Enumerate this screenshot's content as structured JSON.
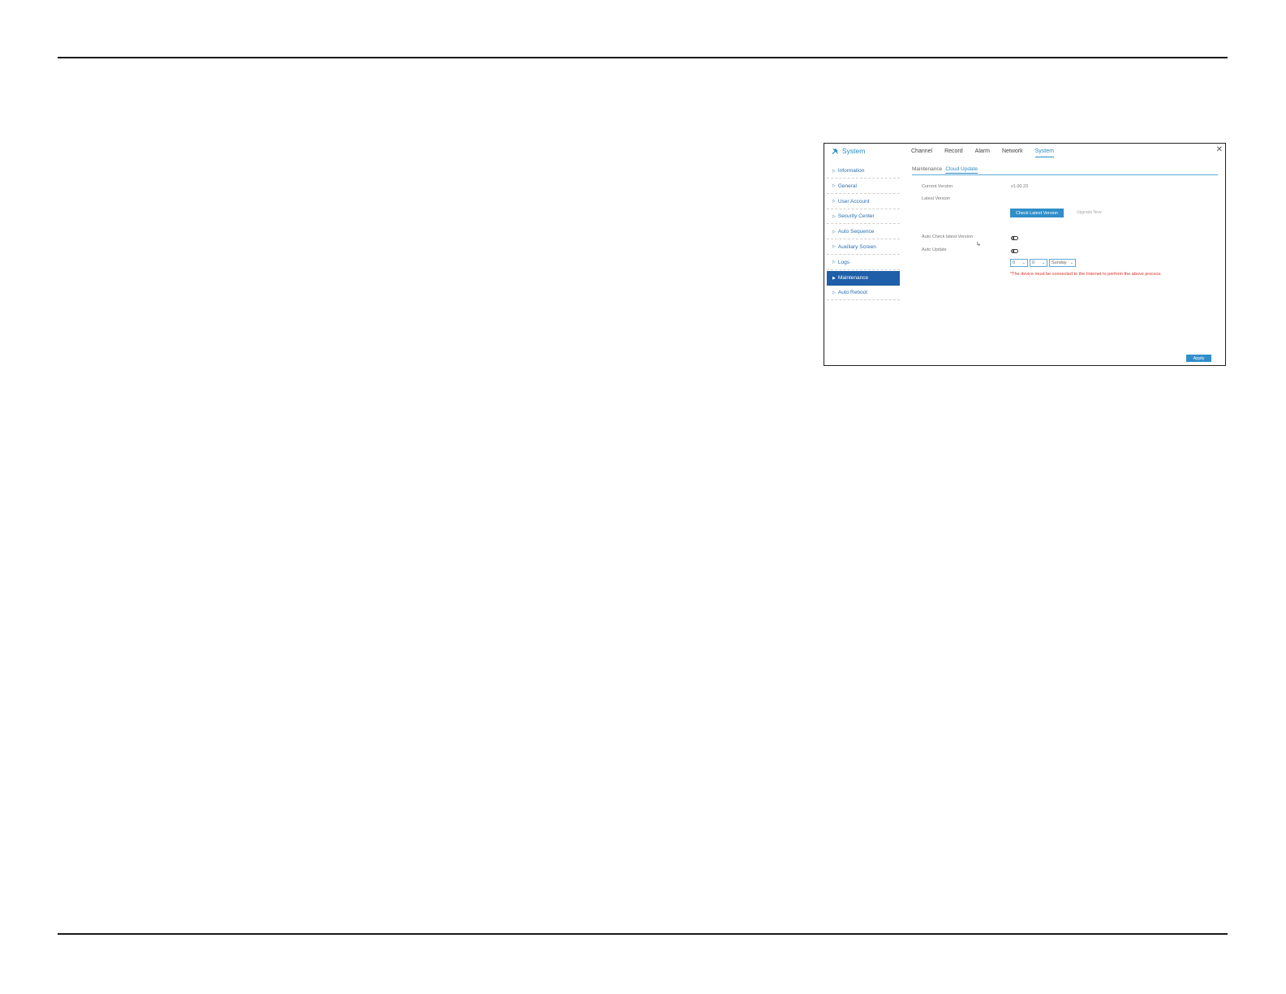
{
  "header": {
    "title": "System"
  },
  "top_tabs": [
    {
      "label": "Channel"
    },
    {
      "label": "Record"
    },
    {
      "label": "Alarm"
    },
    {
      "label": "Network"
    },
    {
      "label": "System"
    }
  ],
  "active_top_tab": "System",
  "sidebar": {
    "items": [
      {
        "label": "Information"
      },
      {
        "label": "General"
      },
      {
        "label": "User Account"
      },
      {
        "label": "Security Center"
      },
      {
        "label": "Auto Sequence"
      },
      {
        "label": "Auxiliary Screen"
      },
      {
        "label": "Logs"
      },
      {
        "label": "Maintenance"
      },
      {
        "label": "Auto Reboot"
      }
    ],
    "active": "Maintenance"
  },
  "sub_tabs": [
    {
      "label": "Maintenance"
    },
    {
      "label": "Cloud Update"
    }
  ],
  "active_sub_tab": "Cloud Update",
  "cloud_update": {
    "current_version_label": "Current Version",
    "current_version_value": "v1.00.23",
    "latest_version_label": "Latest Version",
    "check_button": "Check Latest Version",
    "upgrade_button": "Upgrade Now",
    "auto_check_label": "Auto Check latest Version",
    "auto_update_label": "Auto Update",
    "hour_value": "0",
    "minute_value": "0",
    "day_value": "Sunday",
    "warning": "*The device must be connected to the Internet to perform the above process",
    "apply_button": "Apply"
  },
  "icons": {
    "system": "wrench-hammer-icon",
    "close": "close-icon",
    "arrow": "triangle-right-icon",
    "chevron": "chevron-down-icon"
  },
  "colors": {
    "accent": "#2a8bc4",
    "active_sidebar": "#1f5ea8",
    "warning": "#d9342b"
  }
}
